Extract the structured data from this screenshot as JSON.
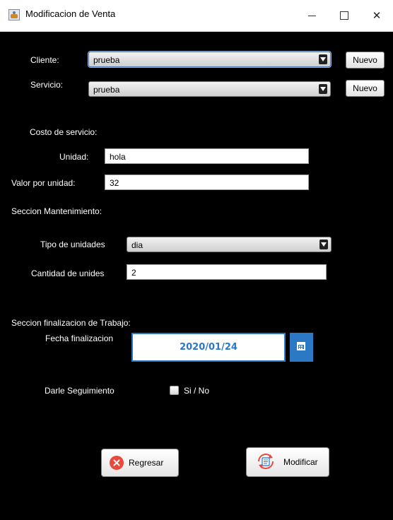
{
  "window": {
    "title": "Modificacion de Venta"
  },
  "cliente": {
    "label": "Cliente:",
    "selected": "prueba",
    "new_button": "Nuevo"
  },
  "servicio": {
    "label": "Servicio:",
    "selected": "prueba",
    "new_button": "Nuevo"
  },
  "costo": {
    "section_title": "Costo de servicio:",
    "unidad_label": "Unidad:",
    "unidad_value": "hola",
    "valor_label": "Valor por unidad:",
    "valor_value": "32"
  },
  "mantenimiento": {
    "section_title": "Seccion Mantenimiento:",
    "tipo_label": "Tipo de unidades",
    "tipo_selected": "dia",
    "cantidad_label": "Cantidad de unides",
    "cantidad_value": "2"
  },
  "finalizacion": {
    "section_title": "Seccion finalizacion de Trabajo:",
    "fecha_label": "Fecha finalizacion",
    "fecha_value": "2020/01/24"
  },
  "seguimiento": {
    "label": "Darle Seguimiento",
    "checkbox_label": "Si / No",
    "checked": false
  },
  "actions": {
    "back_label": "Regresar",
    "modify_label": "Modificar"
  },
  "colors": {
    "background": "#000000",
    "accent": "#2b78c5",
    "danger": "#e84a3c"
  }
}
